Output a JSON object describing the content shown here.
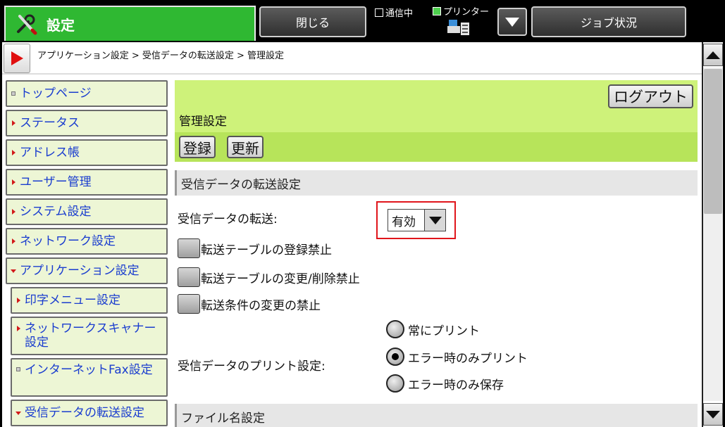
{
  "topbar": {
    "title": "設定",
    "close_label": "閉じる",
    "comm_status": "通信中",
    "printer_status": "プリンター",
    "job_status_label": "ジョブ状況",
    "title_color": "#2fb832"
  },
  "breadcrumb": "アプリケーション設定 > 受信データの転送設定 > 管理設定",
  "sidebar": {
    "items": [
      {
        "label": "トップページ",
        "marker": "square"
      },
      {
        "label": "ステータス",
        "marker": "arrow-right"
      },
      {
        "label": "アドレス帳",
        "marker": "arrow-right"
      },
      {
        "label": "ユーザー管理",
        "marker": "arrow-right"
      },
      {
        "label": "システム設定",
        "marker": "arrow-right"
      },
      {
        "label": "ネットワーク設定",
        "marker": "arrow-right"
      },
      {
        "label": "アプリケーション設定",
        "marker": "arrow-down"
      },
      {
        "label": "印字メニュー設定",
        "marker": "arrow-right"
      },
      {
        "label": "ネットワークスキャナー設定",
        "marker": "arrow-right"
      },
      {
        "label": "インターネットFax設定",
        "marker": "square"
      },
      {
        "label": "受信データの転送設定",
        "marker": "arrow-down"
      }
    ]
  },
  "header": {
    "logout_label": "ログアウト",
    "title": "管理設定",
    "register_label": "登録",
    "update_label": "更新"
  },
  "form": {
    "section1_title": "受信データの転送設定",
    "forward_label": "受信データの転送:",
    "forward_value": "有効",
    "checkboxes": [
      {
        "label": "転送テーブルの登録禁止",
        "checked": false
      },
      {
        "label": "転送テーブルの変更/削除禁止",
        "checked": false
      },
      {
        "label": "転送条件の変更の禁止",
        "checked": false
      }
    ],
    "print_label": "受信データのプリント設定:",
    "print_options": [
      {
        "label": "常にプリント",
        "selected": false
      },
      {
        "label": "エラー時のみプリント",
        "selected": true
      },
      {
        "label": "エラー時のみ保存",
        "selected": false
      }
    ],
    "section2_title": "ファイル名設定"
  },
  "icons": {
    "title_icon": "wrench-screwdriver-icon",
    "printer_icon": "printer-icon",
    "highlight_color": "#e0151b"
  }
}
